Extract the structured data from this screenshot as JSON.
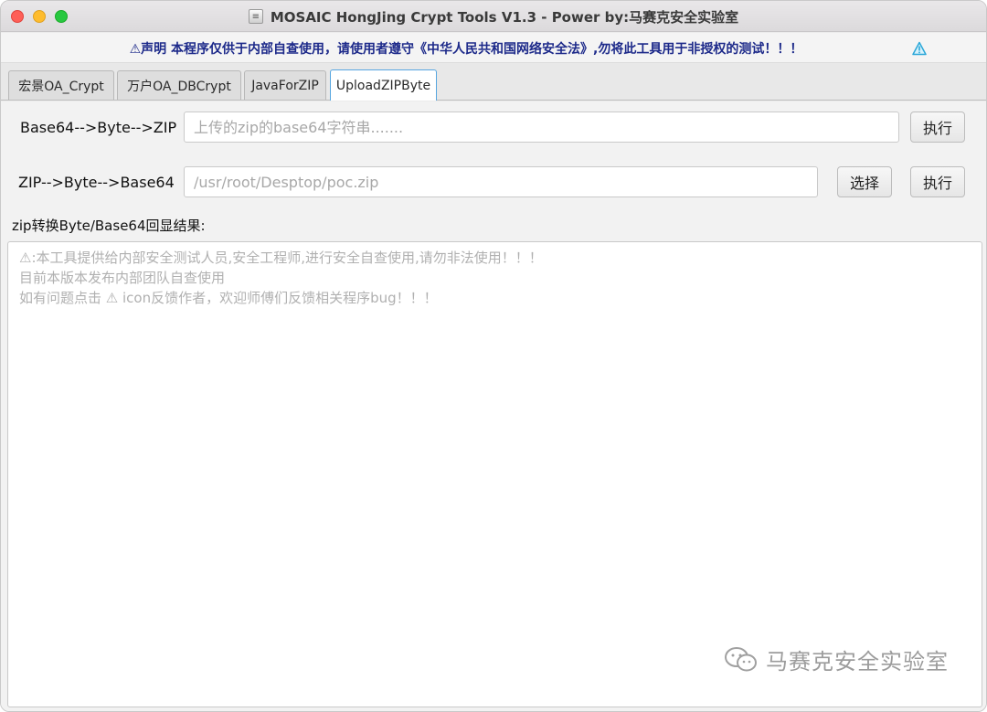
{
  "window": {
    "title": "MOSAIC HongJing Crypt Tools V1.3 - Power by:马赛克安全实验室"
  },
  "notice": {
    "text": "⚠声明 本程序仅供于内部自查使用，请使用者遵守《中华人民共和国网络安全法》,勿将此工具用于非授权的测试！！！",
    "icon": "warning-icon"
  },
  "tabs": [
    {
      "label": "宏景OA_Crypt"
    },
    {
      "label": "万户OA_DBCrypt"
    },
    {
      "label": "JavaForZIP"
    },
    {
      "label": "UploadZIPByte",
      "active": true
    }
  ],
  "row1": {
    "label": "Base64-->Byte-->ZIP",
    "placeholder": "上传的zip的base64字符串.......",
    "execute_label": "执行"
  },
  "row2": {
    "label": "ZIP-->Byte-->Base64",
    "placeholder": "/usr/root/Desptop/poc.zip",
    "select_label": "选择",
    "execute_label": "执行"
  },
  "result": {
    "label": "zip转换Byte/Base64回显结果:",
    "lines": [
      "⚠:本工具提供给内部安全测试人员,安全工程师,进行安全自查使用,请勿非法使用！！！",
      "目前本版本发布内部团队自查使用",
      "如有问题点击 ⚠ icon反馈作者，欢迎师傅们反馈相关程序bug！！！"
    ]
  },
  "watermark": {
    "text": "马赛克安全实验室",
    "icon": "wechat-icon"
  },
  "colors": {
    "notice_text": "#1d2a8a",
    "active_tab_border": "#57a6e0",
    "notice_icon": "#2aa7d8"
  }
}
